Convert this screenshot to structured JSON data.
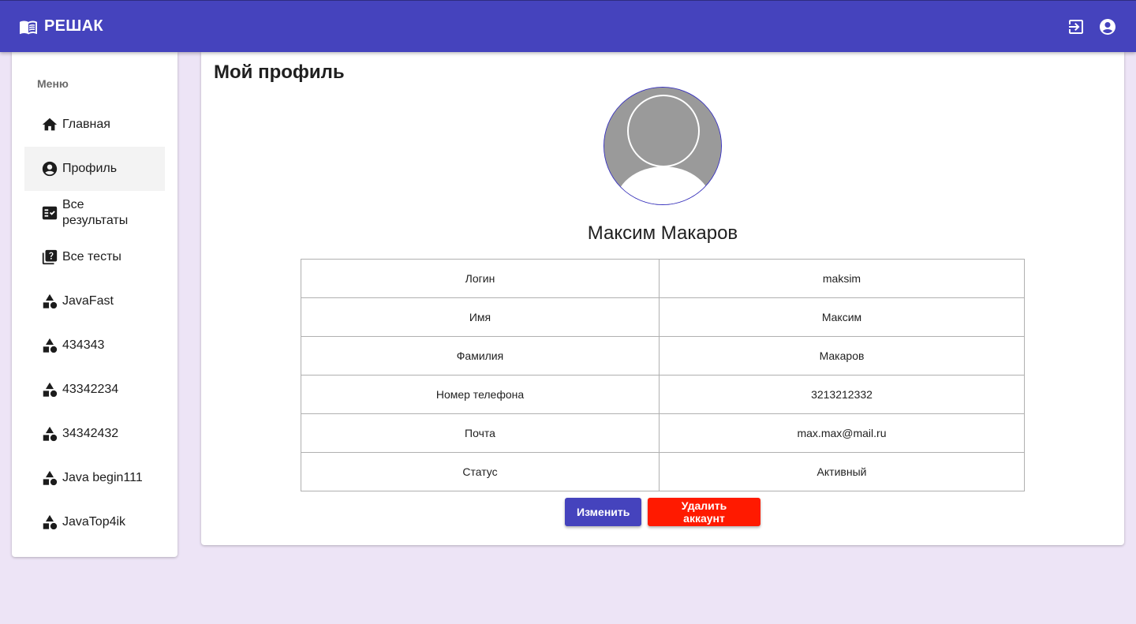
{
  "app": {
    "title": "РЕШАК"
  },
  "colors": {
    "primary": "#4543bd",
    "danger": "#ff1a00",
    "background": "#ede4f6"
  },
  "header_icons": [
    "logout-icon",
    "account-circle-icon"
  ],
  "sidebar": {
    "heading": "Меню",
    "items": [
      {
        "label": "Главная",
        "icon": "home-icon"
      },
      {
        "label": "Профиль",
        "icon": "account-circle-icon",
        "active": true
      },
      {
        "label": "Все результаты",
        "icon": "fact-check-icon"
      },
      {
        "label": "Все тесты",
        "icon": "quiz-icon"
      },
      {
        "label": "JavaFast",
        "icon": "category-icon"
      },
      {
        "label": "434343",
        "icon": "category-icon"
      },
      {
        "label": "43342234",
        "icon": "category-icon"
      },
      {
        "label": "34342432",
        "icon": "category-icon"
      },
      {
        "label": "Java begin111",
        "icon": "category-icon"
      },
      {
        "label": "JavaTop4ik",
        "icon": "category-icon"
      }
    ]
  },
  "profile": {
    "title": "Мой профиль",
    "name": "Максим Макаров",
    "rows": [
      {
        "key": "Логин",
        "value": "maksim"
      },
      {
        "key": "Имя",
        "value": "Максим"
      },
      {
        "key": "Фамилия",
        "value": "Макаров"
      },
      {
        "key": "Номер телефона",
        "value": "3213212332"
      },
      {
        "key": "Почта",
        "value": "max.max@mail.ru"
      },
      {
        "key": "Статус",
        "value": "Активный"
      }
    ],
    "edit_label": "Изменить",
    "delete_label": "Удалить аккаунт"
  }
}
